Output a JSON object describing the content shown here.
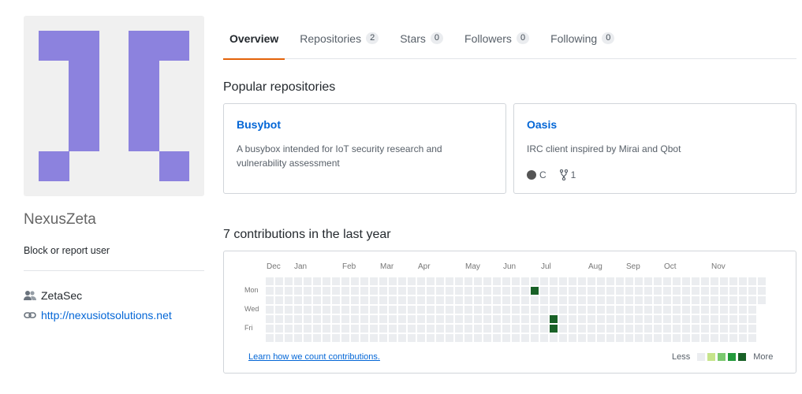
{
  "profile": {
    "username": "NexusZeta",
    "block_label": "Block or report user",
    "organization": "ZetaSec",
    "website": "http://nexusiotsolutions.net",
    "avatar_color": "#8c82de"
  },
  "tabs": [
    {
      "label": "Overview",
      "count": null,
      "active": true
    },
    {
      "label": "Repositories",
      "count": "2",
      "active": false
    },
    {
      "label": "Stars",
      "count": "0",
      "active": false
    },
    {
      "label": "Followers",
      "count": "0",
      "active": false
    },
    {
      "label": "Following",
      "count": "0",
      "active": false
    }
  ],
  "popular": {
    "title": "Popular repositories",
    "repos": [
      {
        "name": "Busybot",
        "description": "A busybox intended for IoT security research and vulnerability assessment"
      },
      {
        "name": "Oasis",
        "description": "IRC client inspired by Mirai and Qbot",
        "language": "C",
        "language_color": "#555555",
        "forks": "1"
      }
    ]
  },
  "contributions": {
    "title": "7 contributions in the last year",
    "months": [
      "Dec",
      "Jan",
      "Feb",
      "Mar",
      "Apr",
      "May",
      "Jun",
      "Jul",
      "Aug",
      "Sep",
      "Oct",
      "Nov"
    ],
    "day_labels": [
      "Mon",
      "Wed",
      "Fri"
    ],
    "active_cells": [
      {
        "week": 28,
        "day": 1,
        "level": 4
      },
      {
        "week": 30,
        "day": 4,
        "level": 4
      },
      {
        "week": 30,
        "day": 5,
        "level": 4
      }
    ],
    "learn_link": "Learn how we count contributions.",
    "legend": {
      "less": "Less",
      "more": "More",
      "colors": [
        "#ebedf0",
        "#c6e48b",
        "#7bc96f",
        "#239a3b",
        "#196127"
      ]
    }
  }
}
